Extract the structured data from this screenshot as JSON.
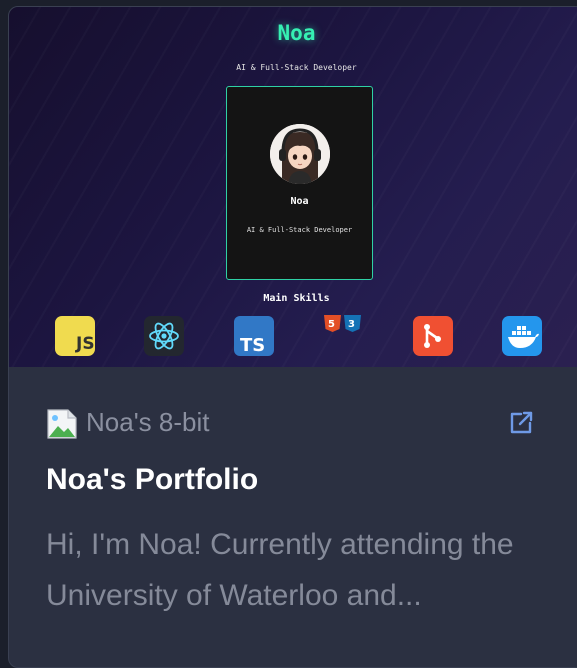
{
  "preview": {
    "brand": "Noa",
    "role": "AI & Full-Stack Developer",
    "profile": {
      "name": "Noa",
      "role": "AI & Full-Stack Developer"
    },
    "skills_title": "Main Skills",
    "skills": [
      {
        "name": "javascript-icon",
        "label": "JS"
      },
      {
        "name": "react-icon",
        "label": ""
      },
      {
        "name": "typescript-icon",
        "label": "TS"
      },
      {
        "name": "html5-css3-icon",
        "label": ""
      },
      {
        "name": "git-icon",
        "label": ""
      },
      {
        "name": "docker-icon",
        "label": ""
      }
    ]
  },
  "link": {
    "site_name": "Noa's 8-bit",
    "title": "Noa's Portfolio",
    "description": "Hi, I'm Noa! Currently attending the University of Waterloo and..."
  },
  "colors": {
    "accent": "#36f0b3",
    "card_bg": "#2b3041",
    "page_bg": "#1b1f2b"
  }
}
